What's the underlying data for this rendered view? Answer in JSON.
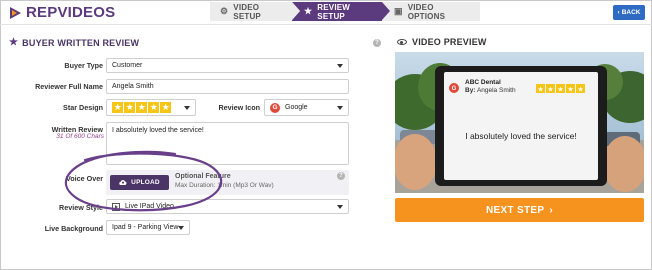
{
  "header": {
    "logo_text": "REPVIDEOS",
    "steps": [
      {
        "label": "VIDEO SETUP",
        "icon": "gears-icon"
      },
      {
        "label": "REVIEW SETUP",
        "icon": "star-icon"
      },
      {
        "label": "VIDEO OPTIONS",
        "icon": "film-icon"
      }
    ],
    "active_step": 1,
    "back_label": "BACK"
  },
  "form": {
    "title": "BUYER WRITTEN REVIEW",
    "buyer_type_label": "Buyer Type",
    "buyer_type_value": "Customer",
    "reviewer_name_label": "Reviewer Full Name",
    "reviewer_name_value": "Angela Smith",
    "star_design_label": "Star Design",
    "star_rating": 5,
    "review_icon_label": "Review Icon",
    "review_icon_value": "Google",
    "written_review_label": "Written Review",
    "char_count": "31 Of 600 Chars",
    "written_review_value": "I absolutely loved the service!",
    "voice_over_label": "Voice Over",
    "upload_label": "UPLOAD",
    "optional_feature": "Optional Feature",
    "max_duration": "Max Duration: 1min (Mp3 Or Wav)",
    "review_style_label": "Review Style",
    "review_style_value": "Live IPad Video",
    "live_background_label": "Live Background",
    "live_background_value": "Ipad 9 - Parking View"
  },
  "preview": {
    "title": "VIDEO PREVIEW",
    "business_name": "ABC Dental",
    "by_prefix": "By:",
    "reviewer": "Angela Smith",
    "review_text": "I absolutely loved the service!",
    "next_label": "NEXT STEP"
  },
  "colors": {
    "brand_purple": "#5b3a7e",
    "next_orange": "#f6921e",
    "back_blue": "#2f6bc2",
    "star_gold": "#f5c518",
    "google_red": "#e04a3a"
  }
}
